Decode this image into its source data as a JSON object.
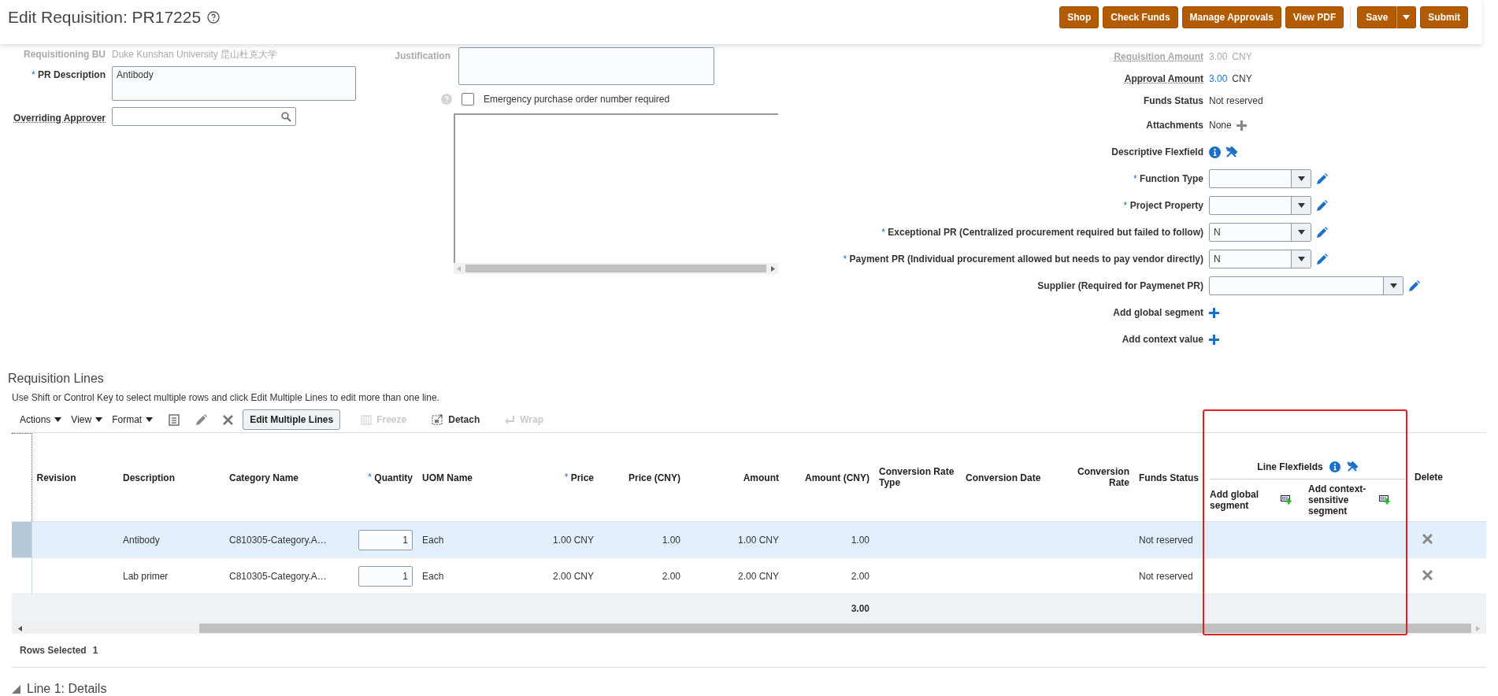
{
  "title": "Edit Requisition: PR17225",
  "actions": [
    {
      "label": "Shop",
      "kind": "button"
    },
    {
      "label": "Check Funds",
      "kind": "button"
    },
    {
      "label": "Manage Approvals",
      "kind": "button"
    },
    {
      "label": "View PDF",
      "kind": "button"
    },
    {
      "label": "Save",
      "kind": "split"
    },
    {
      "label": "Submit",
      "kind": "button"
    }
  ],
  "requisitioning_bu": {
    "label": "Requisitioning BU",
    "value": "Duke Kunshan University 昆山杜克大学",
    "faded": true
  },
  "pr_description": {
    "label": "PR Description",
    "marker": "*",
    "value": "Antibody"
  },
  "overriding_approver": {
    "label": "Overriding Approver"
  },
  "justification": {
    "label": "Justification",
    "faded": true
  },
  "emergency_po": {
    "label": "Emergency purchase order number required",
    "checked": false
  },
  "summary_fields": [
    {
      "kind": "amount",
      "label": "Requisition Amount",
      "value": "3.00",
      "unit": "CNY",
      "faded": true
    },
    {
      "kind": "amount",
      "label": "Approval Amount",
      "value": "3.00",
      "unit": "CNY",
      "faded": false
    },
    {
      "kind": "text",
      "label": "Funds Status",
      "value": "Not reserved"
    },
    {
      "kind": "attachments",
      "label": "Attachments",
      "value": "None"
    },
    {
      "kind": "flexfield",
      "label": "Descriptive Flexfield"
    },
    {
      "kind": "select",
      "label": "Function Type",
      "marker": "*"
    },
    {
      "kind": "select",
      "label": "Project Property",
      "marker": "*"
    },
    {
      "kind": "select",
      "label": "Exceptional PR (Centralized procurement required but failed to follow)",
      "marker": "*",
      "value": "N"
    },
    {
      "kind": "select",
      "label": "Payment PR (Individual procurement allowed but needs to pay vendor directly)",
      "marker": "*",
      "value": "N"
    },
    {
      "kind": "wide-select",
      "label": "Supplier (Required for Paymenet PR)"
    },
    {
      "kind": "add",
      "label": "Add global segment"
    },
    {
      "kind": "add",
      "label": "Add context value"
    }
  ],
  "lines": {
    "title": "Requisition Lines",
    "hint": "Use Shift or Control Key to select multiple rows and click Edit Multiple Lines to edit more than one line.",
    "menus": [
      "Actions",
      "View",
      "Format"
    ],
    "edit_multiple": "Edit Multiple Lines",
    "tools": [
      {
        "kind": "freeze",
        "label": "Freeze",
        "disabled": true
      },
      {
        "kind": "detach",
        "label": "Detach",
        "disabled": false
      },
      {
        "kind": "wrap",
        "label": "Wrap",
        "disabled": true
      }
    ],
    "columns": [
      {
        "label": "Revision"
      },
      {
        "label": "Description"
      },
      {
        "label": "Category Name"
      },
      {
        "label": "Quantity",
        "marker": "*"
      },
      {
        "label": "UOM Name"
      },
      {
        "label": "Price",
        "marker": "*"
      },
      {
        "label": "Price (CNY)"
      },
      {
        "label": "Amount"
      },
      {
        "label": "Amount (CNY)"
      },
      {
        "label": "Conversion Rate Type"
      },
      {
        "label": "Conversion Date"
      },
      {
        "label": "Conversion Rate"
      },
      {
        "label": "Funds Status"
      }
    ],
    "flexfields": {
      "label": "Line Flexfields",
      "columns": [
        "Add global segment",
        "Add context-sensitive segment"
      ]
    },
    "delete_column": "Delete",
    "rows": [
      {
        "selected": true,
        "description": "Antibody",
        "category": "C810305-Category.A…",
        "quantity": "1",
        "uom": "Each",
        "price": "1.00 CNY",
        "price_cny": "1.00",
        "amount": "1.00 CNY",
        "amount_cny": "1.00",
        "funds_status": "Not reserved"
      },
      {
        "selected": false,
        "description": "Lab primer",
        "category": "C810305-Category.A…",
        "quantity": "1",
        "uom": "Each",
        "price": "2.00 CNY",
        "price_cny": "2.00",
        "amount": "2.00 CNY",
        "amount_cny": "2.00",
        "funds_status": "Not reserved"
      }
    ],
    "totals": {
      "amount_cny": "3.00"
    },
    "rows_selected": {
      "label": "Rows Selected",
      "value": "1"
    }
  },
  "details": {
    "title": "Line 1: Details",
    "expanded": true
  }
}
